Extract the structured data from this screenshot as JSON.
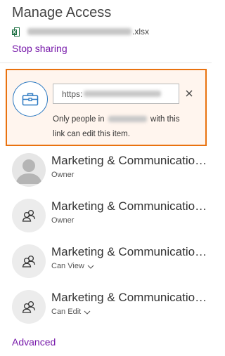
{
  "panel": {
    "title": "Manage Access",
    "file": {
      "extension": ".xlsx",
      "icon": "excel-file-icon",
      "icon_color": "#217346"
    },
    "stop_sharing_label": "Stop sharing",
    "advanced_label": "Advanced"
  },
  "link": {
    "icon": "briefcase-icon",
    "url_prefix": "https:",
    "description_before": "Only people in",
    "description_after": "with this link can edit this item.",
    "close_icon": "close-icon",
    "highlight_color": "#e9720f"
  },
  "people": [
    {
      "name": "Marketing & Communications",
      "role": "Owner",
      "avatar": "person-silhouette-icon"
    },
    {
      "name": "Marketing & Communications",
      "role": "Owner",
      "avatar": "group-icon"
    },
    {
      "name": "Marketing & Communications",
      "role": "Can View",
      "avatar": "group-icon",
      "dropdown": true
    },
    {
      "name": "Marketing & Communications",
      "role": "Can Edit",
      "avatar": "group-icon",
      "dropdown": true
    }
  ],
  "colors": {
    "accent_purple": "#7719aa",
    "icon_blue": "#2b79c2"
  }
}
